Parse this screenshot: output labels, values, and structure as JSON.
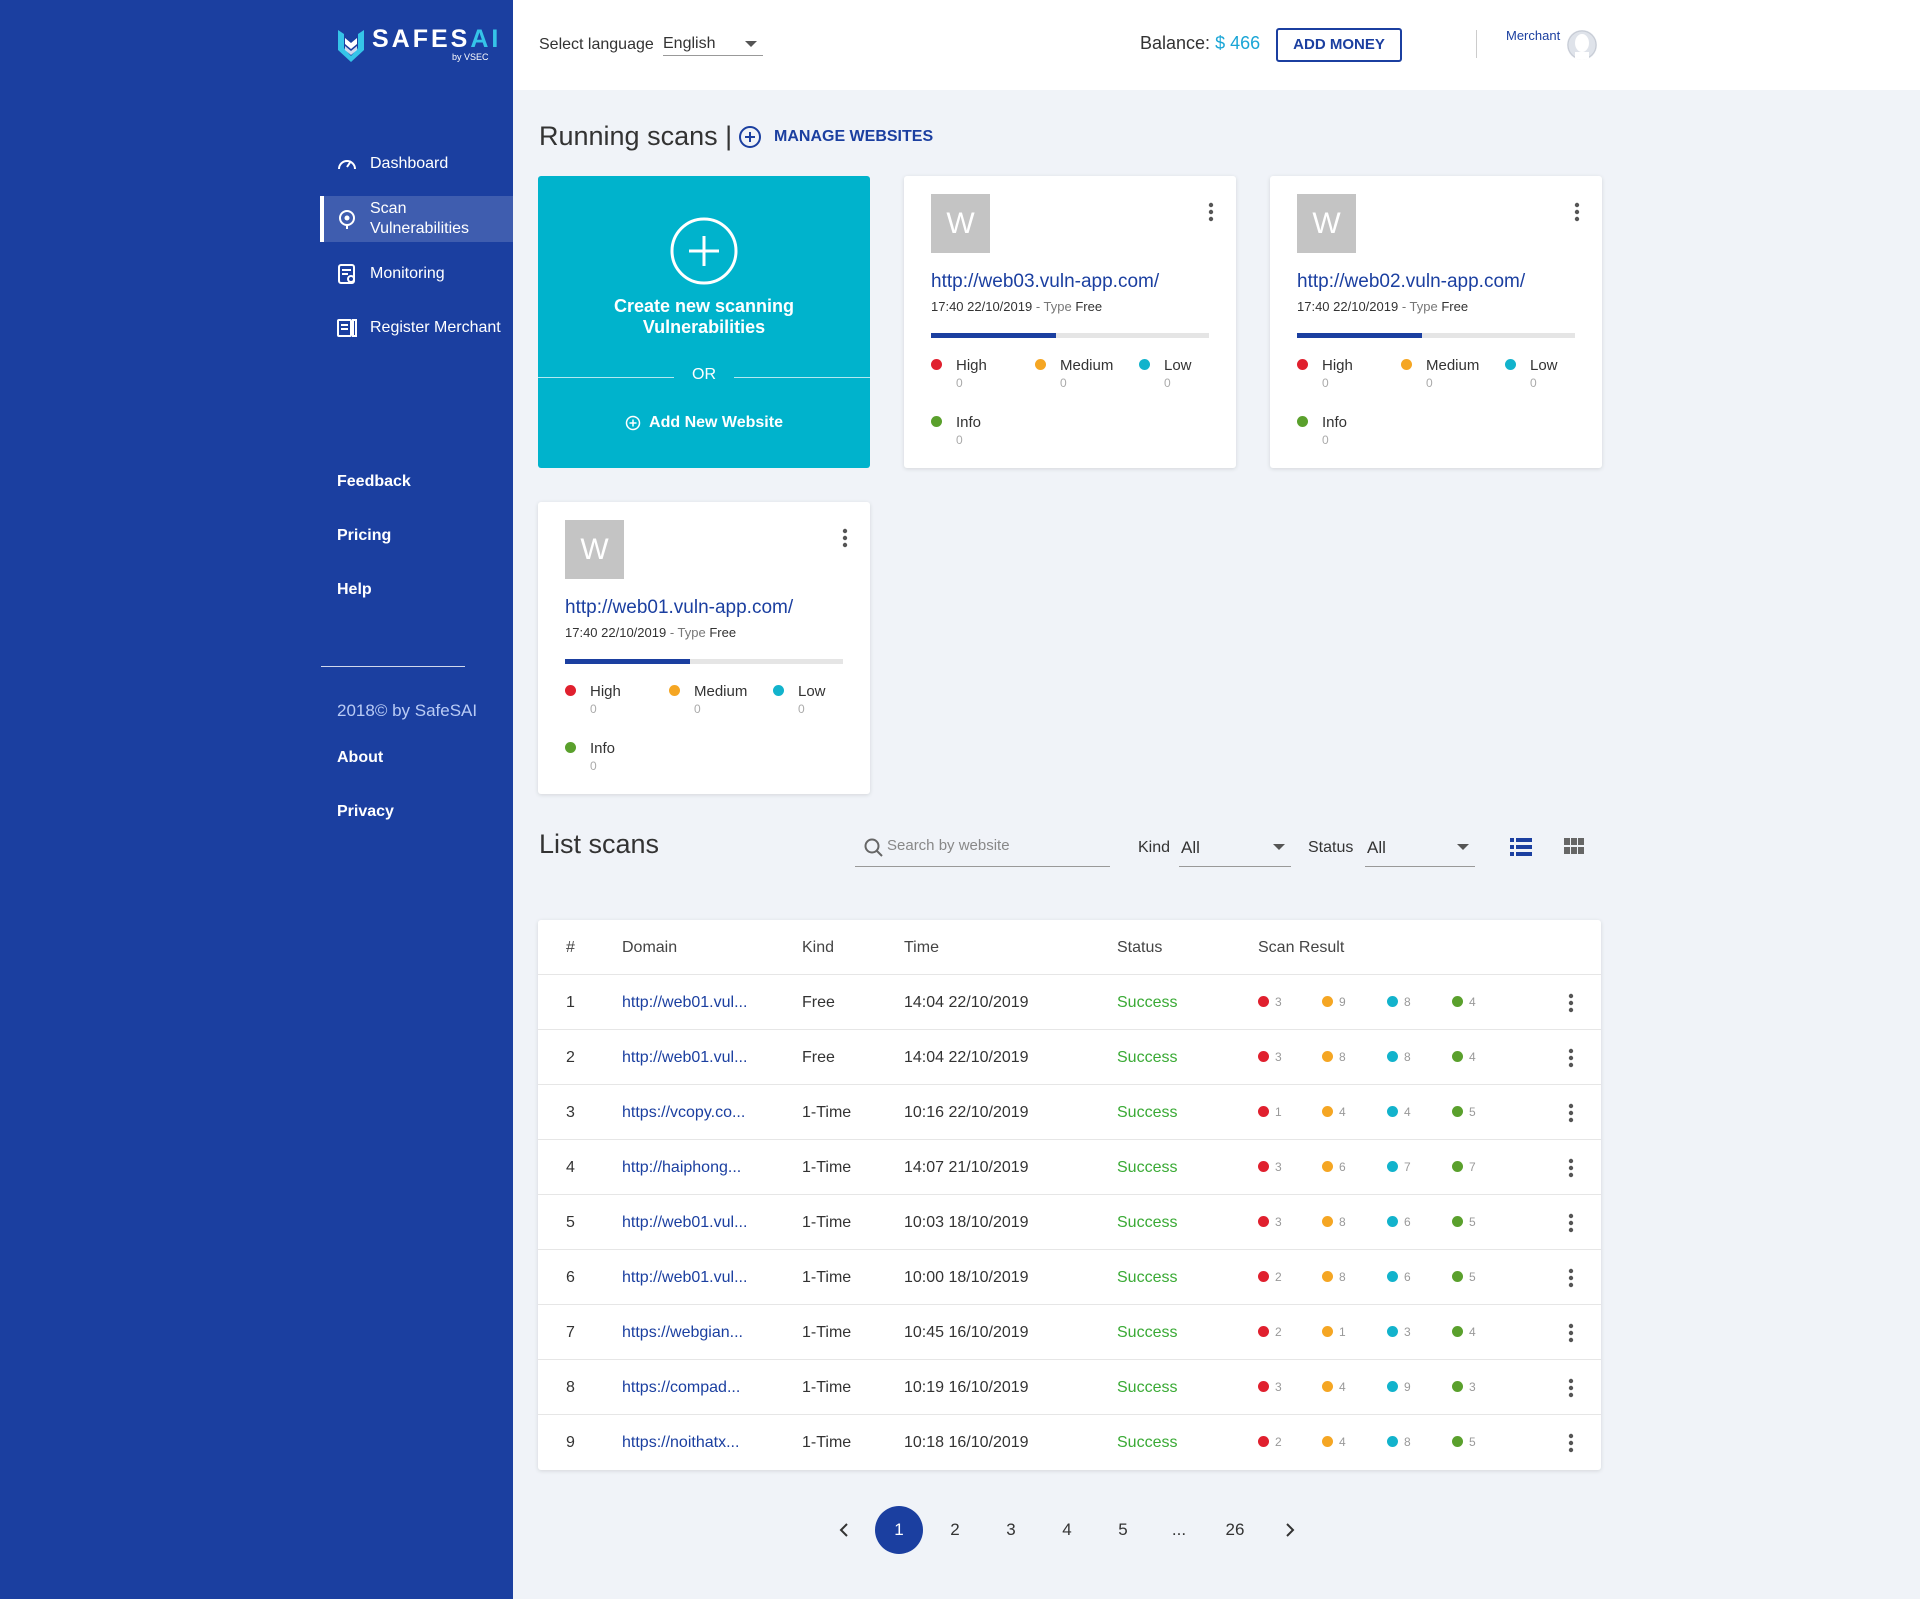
{
  "brand": {
    "name_a": "SAFES",
    "name_b": "AI",
    "sub": "by VSEC",
    "accent": "#1b3fa0",
    "teal": "#00b3cc"
  },
  "sidebar": {
    "nav": [
      {
        "label": "Dashboard",
        "icon": "speedometer-icon"
      },
      {
        "label": "Scan Vulnerabilities",
        "icon": "target-icon",
        "active": true
      },
      {
        "label": "Monitoring",
        "icon": "monitoring-icon"
      },
      {
        "label": "Register Merchant",
        "icon": "register-icon"
      }
    ],
    "links": [
      "Feedback",
      "Pricing",
      "Help"
    ],
    "copyright": "2018© by SafeSAI",
    "links2": [
      "About",
      "Privacy"
    ]
  },
  "header": {
    "lang_label": "Select language",
    "lang_value": "English",
    "balance_label": "Balance:",
    "balance_value": "$ 466",
    "add_money": "ADD MONEY",
    "user_role": "Merchant"
  },
  "running": {
    "title": "Running scans |",
    "manage": "MANAGE WEBSITES",
    "new_card": {
      "line1": "Create new scanning",
      "line2": "Vulnerabilities",
      "or": "OR",
      "add": "Add New Website"
    },
    "cards": [
      {
        "letter": "W",
        "url": "http://web03.vuln-app.com/",
        "time": "17:40 22/10/2019",
        "type_label": "Type",
        "type": "Free",
        "progress": 45,
        "high": "0",
        "medium": "0",
        "low": "0",
        "info": "0"
      },
      {
        "letter": "W",
        "url": "http://web02.vuln-app.com/",
        "time": "17:40 22/10/2019",
        "type_label": "Type",
        "type": "Free",
        "progress": 45,
        "high": "0",
        "medium": "0",
        "low": "0",
        "info": "0"
      },
      {
        "letter": "W",
        "url": "http://web01.vuln-app.com/",
        "time": "17:40 22/10/2019",
        "type_label": "Type",
        "type": "Free",
        "progress": 45,
        "high": "0",
        "medium": "0",
        "low": "0",
        "info": "0"
      }
    ],
    "sev_labels": {
      "high": "High",
      "medium": "Medium",
      "low": "Low",
      "info": "Info"
    },
    "sev_colors": {
      "high": "#e0202e",
      "medium": "#f5a623",
      "low": "#12b3cc",
      "info": "#5aa02c"
    }
  },
  "list": {
    "title": "List scans",
    "search_placeholder": "Search by website",
    "kind_label": "Kind",
    "kind_value": "All",
    "status_label": "Status",
    "status_value": "All",
    "columns": [
      "#",
      "Domain",
      "Kind",
      "Time",
      "Status",
      "Scan Result"
    ],
    "rows": [
      {
        "n": "1",
        "domain": "http://web01.vul...",
        "kind": "Free",
        "time": "14:04 22/10/2019",
        "status": "Success",
        "r": [
          "3",
          "9",
          "8",
          "4"
        ]
      },
      {
        "n": "2",
        "domain": "http://web01.vul...",
        "kind": "Free",
        "time": "14:04 22/10/2019",
        "status": "Success",
        "r": [
          "3",
          "8",
          "8",
          "4"
        ]
      },
      {
        "n": "3",
        "domain": "https://vcopy.co...",
        "kind": "1-Time",
        "time": "10:16 22/10/2019",
        "status": "Success",
        "r": [
          "1",
          "4",
          "4",
          "5"
        ]
      },
      {
        "n": "4",
        "domain": "http://haiphong...",
        "kind": "1-Time",
        "time": "14:07 21/10/2019",
        "status": "Success",
        "r": [
          "3",
          "6",
          "7",
          "7"
        ]
      },
      {
        "n": "5",
        "domain": "http://web01.vul...",
        "kind": "1-Time",
        "time": "10:03 18/10/2019",
        "status": "Success",
        "r": [
          "3",
          "8",
          "6",
          "5"
        ]
      },
      {
        "n": "6",
        "domain": "http://web01.vul...",
        "kind": "1-Time",
        "time": "10:00 18/10/2019",
        "status": "Success",
        "r": [
          "2",
          "8",
          "6",
          "5"
        ]
      },
      {
        "n": "7",
        "domain": "https://webgian...",
        "kind": "1-Time",
        "time": "10:45 16/10/2019",
        "status": "Success",
        "r": [
          "2",
          "1",
          "3",
          "4"
        ]
      },
      {
        "n": "8",
        "domain": "https://compad...",
        "kind": "1-Time",
        "time": "10:19 16/10/2019",
        "status": "Success",
        "r": [
          "3",
          "4",
          "9",
          "3"
        ]
      },
      {
        "n": "9",
        "domain": "https://noithatx...",
        "kind": "1-Time",
        "time": "10:18 16/10/2019",
        "status": "Success",
        "r": [
          "2",
          "4",
          "8",
          "5"
        ]
      }
    ]
  },
  "pagination": {
    "pages": [
      "1",
      "2",
      "3",
      "4",
      "5",
      "...",
      "26"
    ],
    "current": "1"
  }
}
